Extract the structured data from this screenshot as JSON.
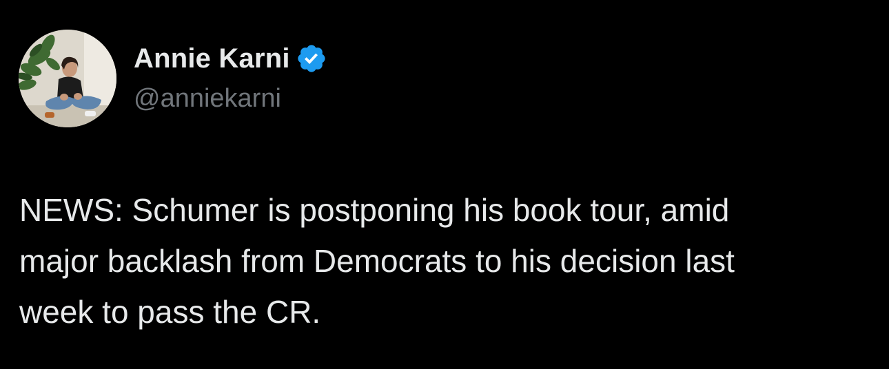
{
  "author": {
    "display_name": "Annie Karni",
    "handle": "@anniekarni",
    "verified_icon": "verified-badge-icon",
    "avatar_icon": "profile-photo"
  },
  "tweet": {
    "lines": [
      "NEWS: Schumer is postponing his book tour, amid",
      "major backlash from Democrats to his decision last",
      "week to pass the CR."
    ]
  },
  "colors": {
    "background": "#000000",
    "primary_text": "#e7e9ea",
    "secondary_text": "#71767b",
    "verified_blue": "#1d9bf0"
  }
}
